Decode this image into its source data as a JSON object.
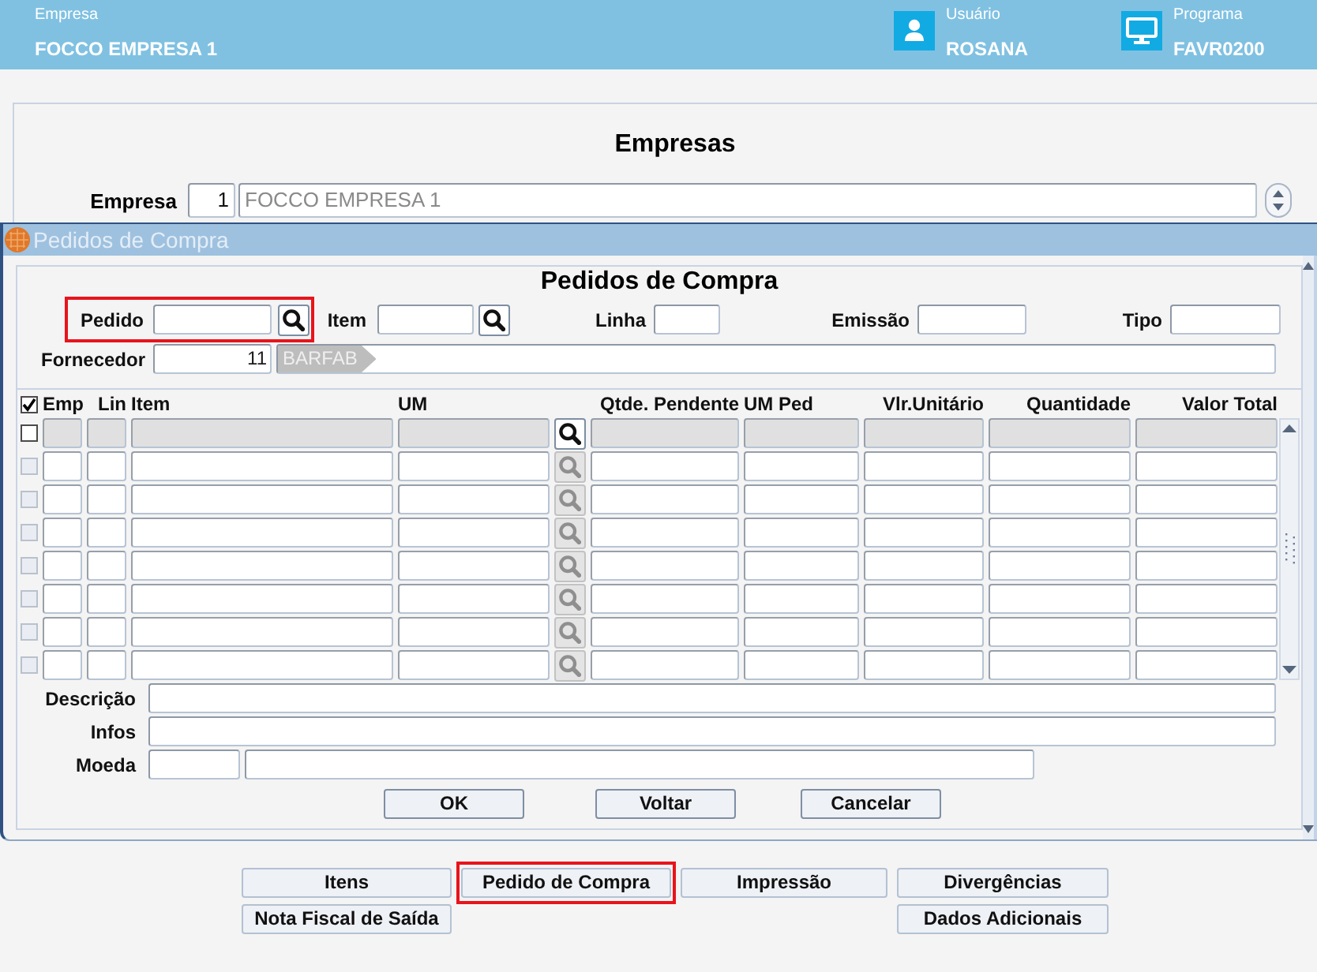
{
  "header": {
    "company_caption": "Empresa",
    "company": "FOCCO EMPRESA 1",
    "user_caption": "Usuário",
    "user": "ROSANA",
    "program_caption": "Programa",
    "program": "FAVR0200"
  },
  "company_panel": {
    "title": "Empresas",
    "label": "Empresa",
    "code": "1",
    "name": "FOCCO EMPRESA 1"
  },
  "dialog": {
    "window_title": "Pedidos de Compra",
    "title": "Pedidos de Compra",
    "filters": [
      {
        "label": "Pedido",
        "kind": "lookup",
        "highlighted": true
      },
      {
        "label": "Item",
        "kind": "lookup",
        "highlighted": false
      },
      {
        "label": "Linha",
        "kind": "text",
        "highlighted": false
      },
      {
        "label": "Emissão",
        "kind": "text",
        "highlighted": false
      },
      {
        "label": "Tipo",
        "kind": "text",
        "highlighted": false
      }
    ],
    "supplier": {
      "label": "Fornecedor",
      "code": "11",
      "name_tag": "BARFAB"
    },
    "table": {
      "header_checked": true,
      "columns": [
        "Emp",
        "Lin",
        "Item",
        "UM",
        "Qtde. Pendente",
        "UM Ped",
        "Vlr.Unitário",
        "Quantidade",
        "Valor Total"
      ],
      "rows": [
        {
          "selected": true,
          "checked": false
        },
        {
          "selected": false,
          "checked": false
        },
        {
          "selected": false,
          "checked": false
        },
        {
          "selected": false,
          "checked": false
        },
        {
          "selected": false,
          "checked": false
        },
        {
          "selected": false,
          "checked": false
        },
        {
          "selected": false,
          "checked": false
        },
        {
          "selected": false,
          "checked": false
        }
      ]
    },
    "bottom_fields": [
      {
        "label": "Descrição",
        "kind": "wide"
      },
      {
        "label": "Infos",
        "kind": "wide"
      },
      {
        "label": "Moeda",
        "kind": "split"
      }
    ],
    "buttons": [
      "OK",
      "Voltar",
      "Cancelar"
    ]
  },
  "nav_buttons": [
    [
      {
        "label": "Itens",
        "highlighted": false
      },
      {
        "label": "Pedido de Compra",
        "highlighted": true
      },
      {
        "label": "Impressão",
        "highlighted": false
      },
      {
        "label": "Divergências",
        "highlighted": false
      }
    ],
    [
      {
        "label": "Nota Fiscal de Saída",
        "highlighted": false
      },
      {
        "label": "Dados Adicionais",
        "highlighted": false
      }
    ]
  ]
}
